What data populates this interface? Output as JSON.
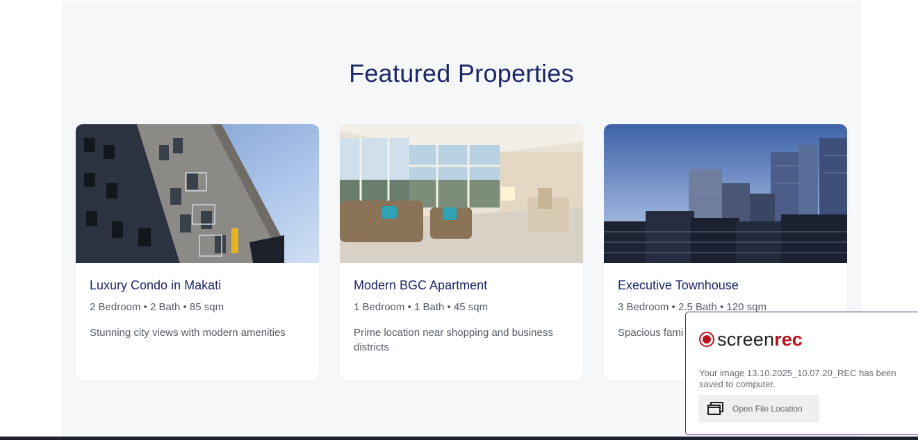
{
  "section": {
    "title": "Featured Properties"
  },
  "properties": [
    {
      "title": "Luxury Condo in Makati",
      "specs": "2 Bedroom • 2 Bath • 85 sqm",
      "description": "Stunning city views with modern amenities",
      "image": "condo-building-photo"
    },
    {
      "title": "Modern BGC Apartment",
      "specs": "1 Bedroom • 1 Bath • 45 sqm",
      "description": "Prime location near shopping and business districts",
      "image": "living-room-photo"
    },
    {
      "title": "Executive Townhouse",
      "specs": "3 Bedroom • 2.5 Bath • 120 sqm",
      "description": "Spacious fami",
      "image": "city-skyline-photo"
    }
  ],
  "toast": {
    "logo_screen": "screen",
    "logo_rec": "rec",
    "message": "Your image 13.10.2025_10.07.20_REC has been saved to computer.",
    "button_label": "Open File Location",
    "button_icon": "window-stack-icon"
  },
  "colors": {
    "heading": "#1b2767",
    "section_bg": "#f6f7f9",
    "brand_red": "#b8121b",
    "toast_border": "#5b2a7a"
  }
}
